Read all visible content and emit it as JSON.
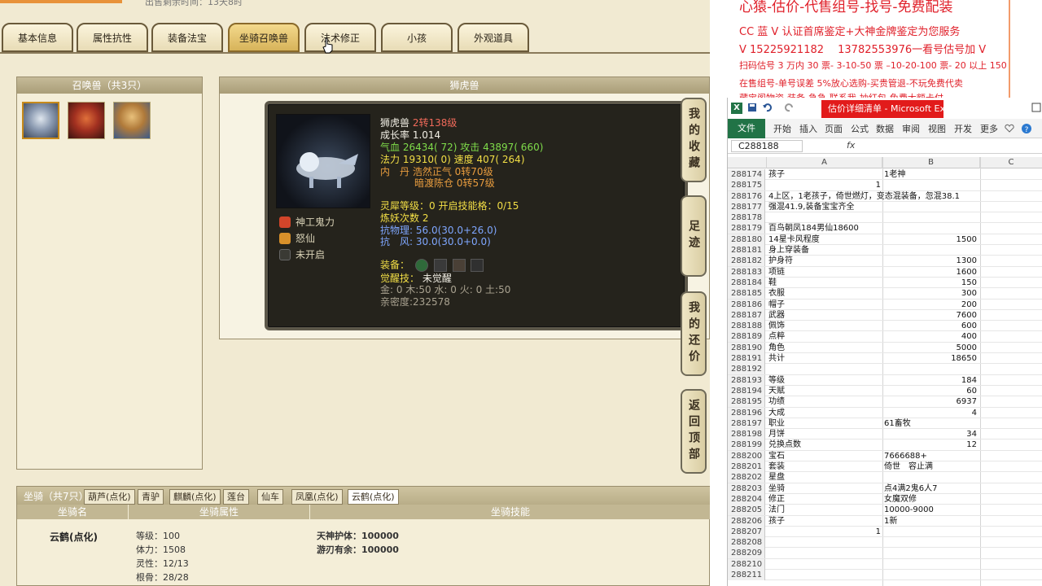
{
  "game": {
    "top_text": "出售剩余时间：13天8时",
    "tabs": [
      {
        "label": "基本信息"
      },
      {
        "label": "属性抗性"
      },
      {
        "label": "装备法宝"
      },
      {
        "label": "坐骑召唤兽"
      },
      {
        "label": "法术修正"
      },
      {
        "label": "小孩"
      },
      {
        "label": "外观道具"
      }
    ],
    "pets_title": "召唤兽（共3只）",
    "detail_title": "狮虎兽",
    "pet": {
      "name": "狮虎兽",
      "level": "2转138级",
      "growth": "成长率 1.014",
      "hp_label": "气血",
      "hp": "26434( 72)",
      "atk_label": "攻击",
      "atk": "43897( 660)",
      "mp_label": "法力",
      "mp": "19310( 0)",
      "spd_label": "速度",
      "spd": "407( 264)",
      "neidan_label": "内　丹",
      "neidan1": "浩然正气 0转70级",
      "neidan2": "暗渡陈仓 0转57级",
      "spirit": "灵犀等级：0 开启技能格：0/15",
      "refine": "炼妖次数 2",
      "res_phys": "抗物理: 56.0(30.0+26.0)",
      "res_wind": "抗　风: 30.0(30.0+0.0)",
      "equip_label": "装备：",
      "awaken_label": "觉醒技：",
      "awaken": "未觉醒",
      "elements": "金: 0 木:50 水: 0 火: 0 土:50",
      "intimacy": "亲密度:232578"
    },
    "skills": [
      {
        "label": "神工鬼力"
      },
      {
        "label": "怒仙"
      },
      {
        "label": "未开启"
      }
    ],
    "side_buttons": [
      {
        "label": "我的收藏"
      },
      {
        "label": "足迹"
      },
      {
        "label": "我的还价"
      },
      {
        "label": "返回顶部"
      }
    ],
    "mount": {
      "title": "坐骑（共7只）",
      "tabs": [
        "葫芦(点化)",
        "青驴",
        "麒麟(点化)",
        "莲台",
        "仙车",
        "凤凰(点化)",
        "云鹤(点化)"
      ],
      "headers": [
        "坐骑名",
        "坐骑属性",
        "坐骑技能"
      ],
      "name": "云鹤(点化)",
      "attrs": [
        "等级：100",
        "体力：1508",
        "灵性：12/13",
        "根骨：28/28"
      ],
      "skills": [
        "天神护体：100000",
        "游刃有余：100000"
      ]
    }
  },
  "notes": {
    "headline": "心猿-估价-代售组号-找号-免费配装",
    "lines": [
      "CC 蓝 V 认证首席鉴定+大神金牌鉴定为您服务",
      "V 15225921182　 13782553976一看号估号加 V",
      "扫码估号 3 万内 30 票- 3-10-50 票 –10-20-100 票- 20 以上 150",
      "在售组号-单号误差 5%放心选购-买贵管退-不玩免费代卖",
      "藏宝阁物资-装备-急急-联系我-抽红包-免费大额卡付"
    ]
  },
  "excel": {
    "title": "估价详细清单 - Microsoft Excel(...",
    "ribbon_tabs": [
      "文件",
      "开始",
      "插入",
      "页面",
      "公式",
      "数据",
      "审阅",
      "视图",
      "开发",
      "更多"
    ],
    "name_box": "C288188",
    "fx": "fx",
    "columns": [
      "A",
      "B",
      "C"
    ],
    "rows": [
      {
        "n": "288174",
        "a": "孩子",
        "b": "1老神",
        "bnum": false
      },
      {
        "n": "288175",
        "a": "1",
        "b": "",
        "anum": true
      },
      {
        "n": "288176",
        "a": "4上区，1老孩子，倚世燃灯，变态混装备，忽混38.1",
        "b": ""
      },
      {
        "n": "288177",
        "a": "强混41.9,装备宝宝齐全",
        "b": ""
      },
      {
        "n": "288178",
        "a": "",
        "b": ""
      },
      {
        "n": "288179",
        "a": "百鸟朝凤184男仙18600",
        "b": ""
      },
      {
        "n": "288180",
        "a": "14星卡风程度",
        "b": "1500",
        "bnum": true
      },
      {
        "n": "288181",
        "a": "身上穿装备",
        "b": ""
      },
      {
        "n": "288182",
        "a": "护身符",
        "b": "1300",
        "bnum": true
      },
      {
        "n": "288183",
        "a": "项链",
        "b": "1600",
        "bnum": true
      },
      {
        "n": "288184",
        "a": "鞋",
        "b": "150",
        "bnum": true
      },
      {
        "n": "288185",
        "a": "衣服",
        "b": "300",
        "bnum": true
      },
      {
        "n": "288186",
        "a": "帽子",
        "b": "200",
        "bnum": true
      },
      {
        "n": "288187",
        "a": "武器",
        "b": "7600",
        "bnum": true
      },
      {
        "n": "288188",
        "a": "佩饰",
        "b": "600",
        "bnum": true
      },
      {
        "n": "288189",
        "a": "点粹",
        "b": "400",
        "bnum": true
      },
      {
        "n": "288190",
        "a": "角色",
        "b": "5000",
        "bnum": true
      },
      {
        "n": "288191",
        "a": "共计",
        "b": "18650",
        "bnum": true
      },
      {
        "n": "288192",
        "a": "",
        "b": ""
      },
      {
        "n": "288193",
        "a": "等级",
        "b": "184",
        "bnum": true
      },
      {
        "n": "288194",
        "a": "天赋",
        "b": "60",
        "bnum": true
      },
      {
        "n": "288195",
        "a": "功绩",
        "b": "6937",
        "bnum": true
      },
      {
        "n": "288196",
        "a": "大成",
        "b": "4",
        "bnum": true
      },
      {
        "n": "288197",
        "a": "职业",
        "b": "61畜牧"
      },
      {
        "n": "288198",
        "a": "月饼",
        "b": "34",
        "bnum": true
      },
      {
        "n": "288199",
        "a": "兑换点数",
        "b": "12",
        "bnum": true
      },
      {
        "n": "288200",
        "a": "宝石",
        "b": "7666688+"
      },
      {
        "n": "288201",
        "a": "套装",
        "b": "倚世　容止满"
      },
      {
        "n": "288202",
        "a": "星盘",
        "b": ""
      },
      {
        "n": "288203",
        "a": "坐骑",
        "b": "点4满2鬼6人7"
      },
      {
        "n": "288204",
        "a": "修正",
        "b": "女魔双修"
      },
      {
        "n": "288205",
        "a": "法门",
        "b": "10000-9000"
      },
      {
        "n": "288206",
        "a": "孩子",
        "b": "1新"
      },
      {
        "n": "288207",
        "a": "1",
        "b": "",
        "anum": true
      },
      {
        "n": "288208",
        "a": "",
        "b": ""
      },
      {
        "n": "288209",
        "a": "",
        "b": ""
      },
      {
        "n": "288210",
        "a": "",
        "b": ""
      },
      {
        "n": "288211",
        "a": "",
        "b": ""
      }
    ]
  }
}
